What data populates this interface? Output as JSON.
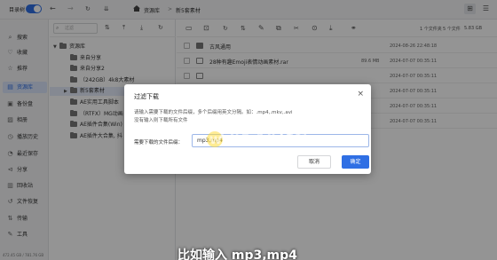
{
  "topbar": {
    "tree_toggle_label": "目录树",
    "back": "←",
    "forward": "→",
    "breadcrumb": [
      "资源库",
      "新5套素材"
    ],
    "breadcrumb_sep": ">"
  },
  "sidenav": {
    "items": [
      {
        "label": "搜索",
        "icon": "search-icon",
        "glyph": "⌕"
      },
      {
        "label": "收藏",
        "icon": "heart-icon",
        "glyph": "♡"
      },
      {
        "label": "推荐",
        "icon": "thumb-icon",
        "glyph": "☆"
      },
      {
        "label": "资源库",
        "icon": "library-icon",
        "glyph": "▤",
        "active": true
      },
      {
        "label": "备份盘",
        "icon": "backup-icon",
        "glyph": "▣"
      },
      {
        "label": "相册",
        "icon": "photo-icon",
        "glyph": "▨"
      },
      {
        "label": "播放历史",
        "icon": "history-icon",
        "glyph": "◷"
      },
      {
        "label": "最近保存",
        "icon": "recent-icon",
        "glyph": "◔"
      },
      {
        "label": "分享",
        "icon": "share-icon",
        "glyph": "⊲"
      },
      {
        "label": "回收站",
        "icon": "trash-icon",
        "glyph": "▥"
      },
      {
        "label": "文件恢复",
        "icon": "restore-icon",
        "glyph": "↺"
      },
      {
        "label": "传输",
        "icon": "transfer-icon",
        "glyph": "⇅"
      },
      {
        "label": "工具",
        "icon": "tools-icon",
        "glyph": "✎"
      }
    ],
    "storage": "472.45 GB / 781.76 GB"
  },
  "tree": {
    "search_placeholder": "过滤",
    "nodes": [
      {
        "label": "资源库",
        "expanded": true,
        "level": 0
      },
      {
        "label": "来自分享",
        "level": 1
      },
      {
        "label": "来自分享2",
        "level": 1
      },
      {
        "label": "（242GB）4k8大素材",
        "level": 1
      },
      {
        "label": "新5套素材",
        "level": 1,
        "selected": true,
        "expandable": true
      },
      {
        "label": "AE实用工具脚本",
        "level": 1
      },
      {
        "label": "（RTFX）MG动画",
        "level": 1
      },
      {
        "label": "AE插件合集(Win)",
        "level": 1
      },
      {
        "label": "AE插件大合集, 抖",
        "level": 1
      }
    ]
  },
  "main": {
    "counts": [
      "1 个文件夹",
      "5 个文件",
      "5.83 GB"
    ],
    "rows": [
      {
        "type": "folder",
        "name": "古风通用",
        "size": "",
        "date": "2024-08-26 22:48:18"
      },
      {
        "type": "file",
        "name": "28种有趣Emoji表情动画素材.rar",
        "size": "89.6 MB",
        "date": "2024-07-07 00:35:11"
      },
      {
        "type": "file",
        "name": "",
        "size": "",
        "date": "2024-07-07 00:35:11"
      },
      {
        "type": "file",
        "name": "",
        "size": "",
        "date": "2024-07-07 00:35:11"
      },
      {
        "type": "file",
        "name": "",
        "size": "",
        "date": "2024-07-07 00:35:11"
      },
      {
        "type": "file",
        "name": "",
        "size": "",
        "date": "2024-07-07 00:35:11"
      }
    ]
  },
  "dialog": {
    "title": "过滤下载",
    "close": "×",
    "desc_line1": "请输入需要下载的文件后缀，多个后缀用英文分隔。如：.mp4,.mkv,.avi",
    "desc_line2": "没有输入则下载所有文件",
    "input_label": "需要下载的文件后缀：",
    "input_value": "mp3,mp4",
    "cancel_label": "取消",
    "ok_label": "确定"
  },
  "watermark": {
    "logo": "代码狗网",
    "url": "www.dmjf.top"
  },
  "subtitle": "比如输入 mp3,mp4",
  "colors": {
    "accent": "#2f6fe4",
    "overlay": "rgba(0,0,0,0.42)"
  }
}
